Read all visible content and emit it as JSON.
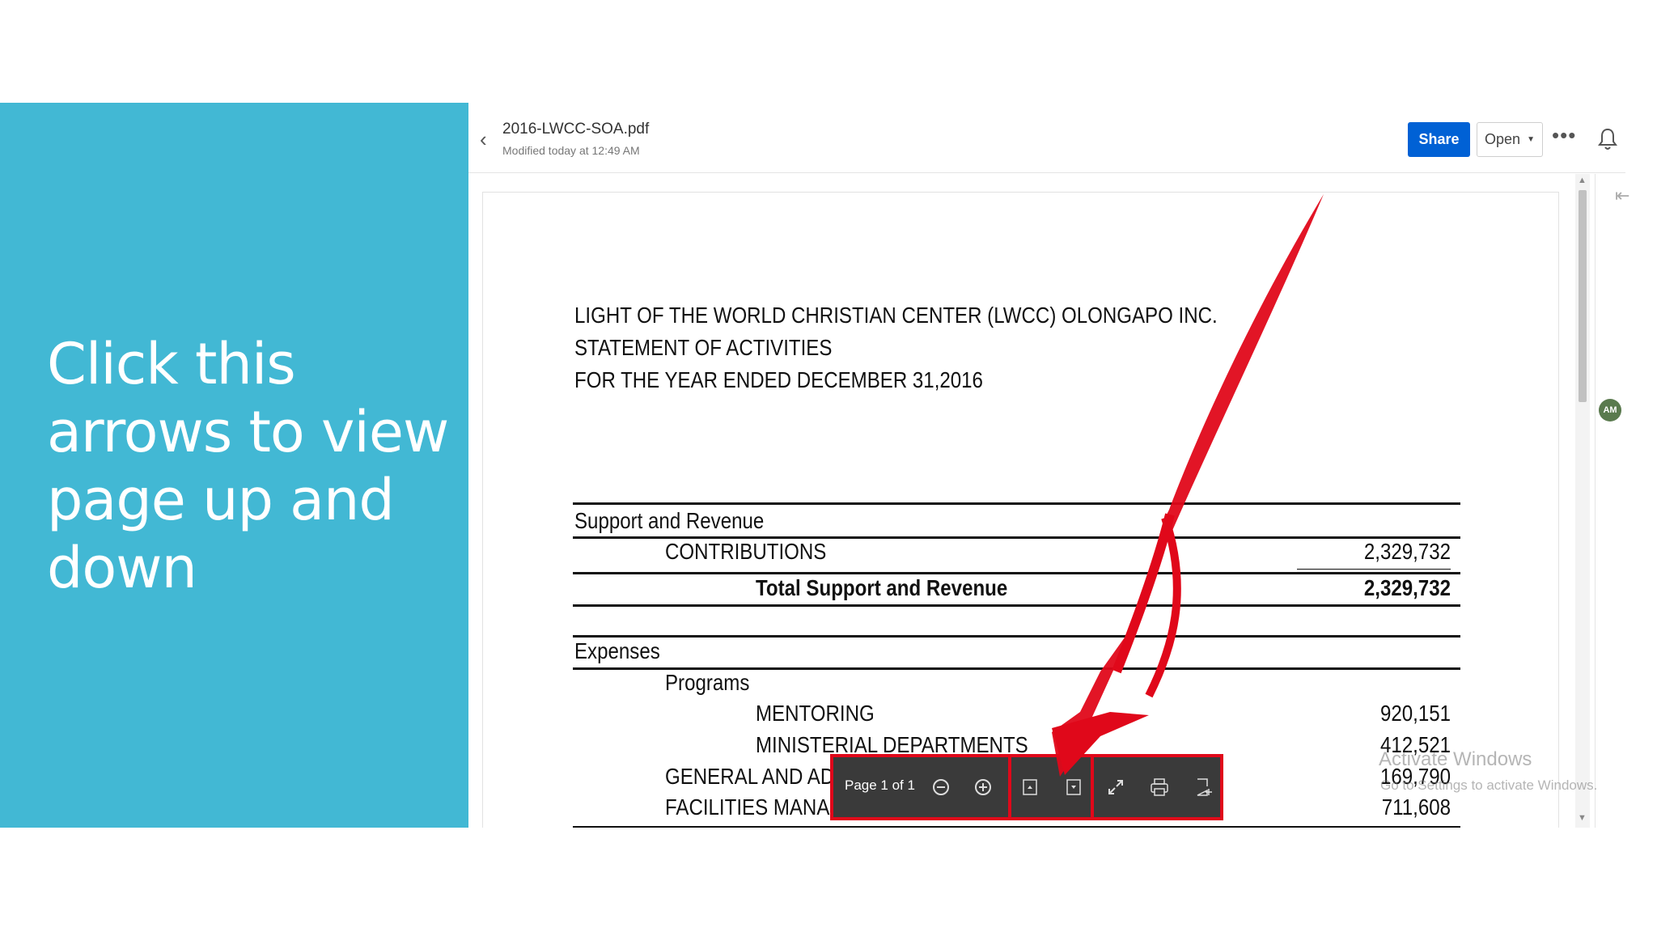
{
  "slide": {
    "instruction": "Click this arrows to view page up and down",
    "panel_color": "#42b8d4"
  },
  "header": {
    "back_icon": "chevron-left-icon",
    "file_name": "2016-LWCC-SOA.pdf",
    "modified": "Modified today at 12:49 AM",
    "share_label": "Share",
    "open_label": "Open",
    "more_label": "•••",
    "accent_color": "#0061d5"
  },
  "sidebar": {
    "avatar_initials": "AM"
  },
  "document": {
    "title_lines": [
      "LIGHT OF THE WORLD CHRISTIAN CENTER (LWCC) OLONGAPO INC.",
      "STATEMENT OF ACTIVITIES",
      "FOR THE YEAR ENDED DECEMBER 31,2016"
    ],
    "support_heading": "Support and Revenue",
    "contributions_label": "CONTRIBUTIONS",
    "contributions_value": "2,329,732",
    "total_support_label": "Total Support and Revenue",
    "total_support_value": "2,329,732",
    "expenses_heading": "Expenses",
    "programs_label": "Programs",
    "mentoring_label": "MENTORING",
    "mentoring_value": "920,151",
    "ministerial_label": "MINISTERIAL DEPARTMENTS",
    "ministerial_value": "412,521",
    "general_label": "GENERAL AND AD",
    "general_value": "169,790",
    "facilities_label": "FACILITIES MANA",
    "facilities_value": "711,608"
  },
  "toolbar": {
    "page_indicator": "Page 1 of 1",
    "highlight_color": "#e0081a"
  },
  "watermark": {
    "line1": "Activate Windows",
    "line2": "Go to Settings to activate Windows."
  }
}
